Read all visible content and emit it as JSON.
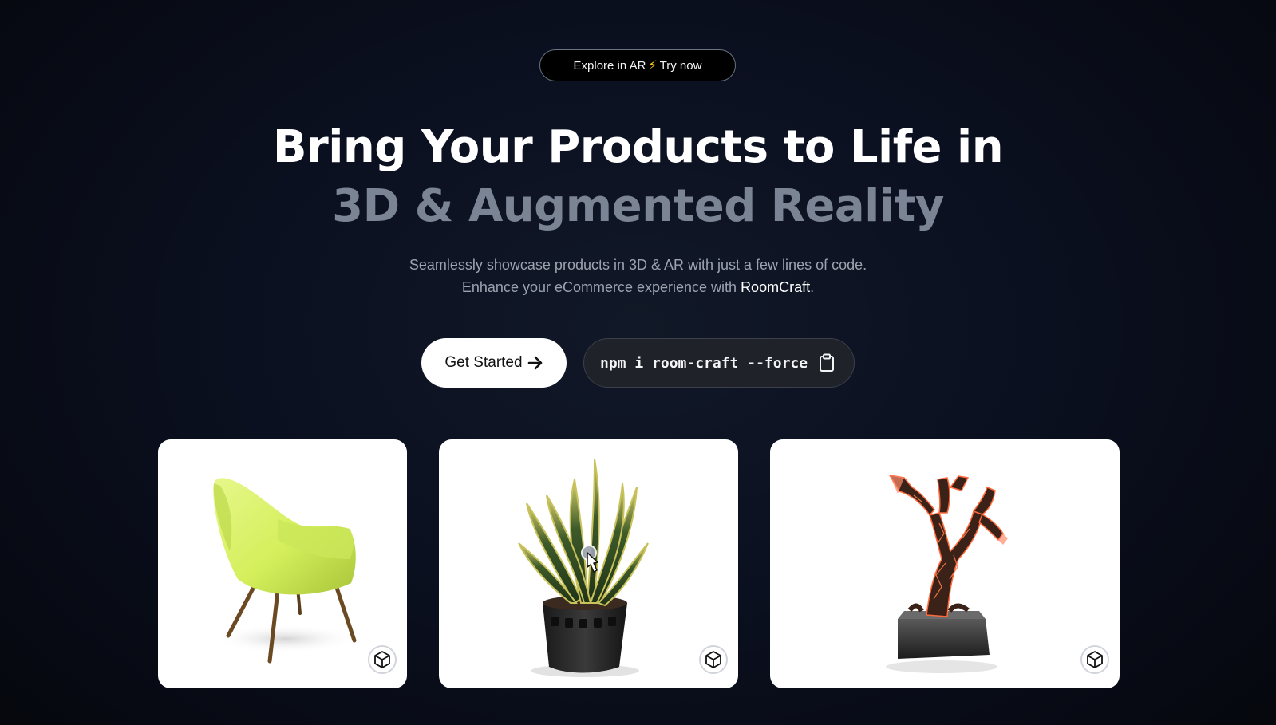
{
  "badge": {
    "prefix": "Explore in AR",
    "bolt_icon": "⚡",
    "suffix": "Try now"
  },
  "hero": {
    "line1": "Bring Your Products to Life in",
    "line2": "3D & Augmented Reality"
  },
  "subtitle": {
    "line1": "Seamlessly showcase products in 3D & AR with just a few lines of code.",
    "line2_prefix": "Enhance your eCommerce experience with ",
    "brand": "RoomCraft",
    "line2_suffix": "."
  },
  "cta": {
    "label": "Get Started",
    "icon": "arrow-right-icon"
  },
  "install": {
    "command": "npm i room-craft --force",
    "icon": "clipboard-icon"
  },
  "models": [
    {
      "name": "chair",
      "ar_icon": "cube-icon"
    },
    {
      "name": "plant",
      "ar_icon": "cube-icon"
    },
    {
      "name": "lava-tree",
      "ar_icon": "cube-icon"
    }
  ],
  "colors": {
    "accent_text": "#7b8494",
    "chair": "#d4ef5b",
    "lava": "#ff6a3d"
  }
}
